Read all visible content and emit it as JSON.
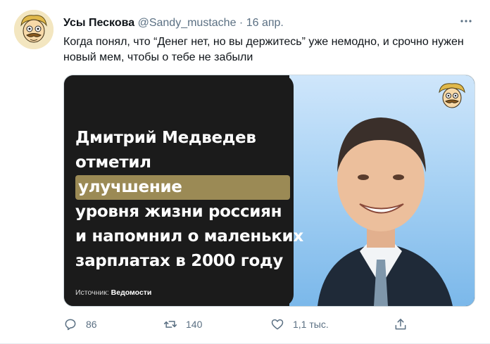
{
  "tweet": {
    "display_name": "Усы Пескова",
    "handle": "@Sandy_mustache",
    "dot": "·",
    "date": "16 апр.",
    "more_icon": "more-horizontal-icon",
    "text": "Когда понял, что “Денег нет, но вы держитесь” уже немодно, и срочно нужен новый мем, чтобы о тебе не забыли"
  },
  "media": {
    "headline_line1": "Дмитрий Медведев",
    "headline_line2_prefix": "отметил ",
    "headline_line2_highlight": "улучшение",
    "headline_line3": "уровня жизни россиян",
    "headline_line4": "и напомнил о маленьких",
    "headline_line5": "зарплатах в 2000 году",
    "source_label": "Источник: ",
    "source_name": "Ведомости",
    "highlight_color": "#9b8a55"
  },
  "actions": {
    "reply_count": "86",
    "retweet_count": "140",
    "like_count": "1,1 тыс.",
    "reply_icon": "reply-icon",
    "retweet_icon": "retweet-icon",
    "like_icon": "heart-icon",
    "share_icon": "share-icon"
  }
}
